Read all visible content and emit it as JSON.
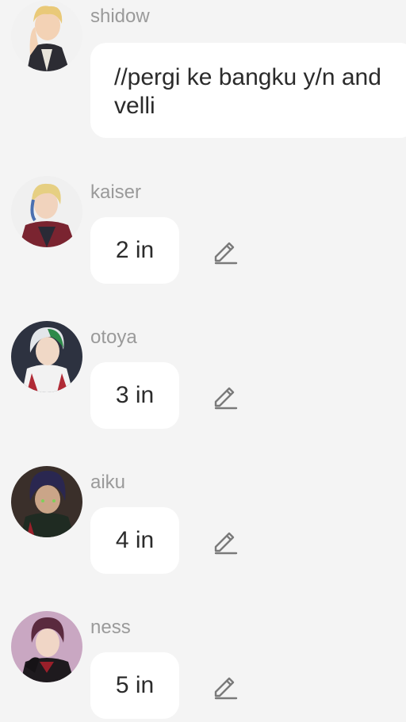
{
  "messages": [
    {
      "name": "shidow",
      "text": "//pergi ke bangku y/n and velli"
    },
    {
      "name": "kaiser",
      "text": "2 in"
    },
    {
      "name": "otoya",
      "text": "3 in"
    },
    {
      "name": "aiku",
      "text": "4 in"
    },
    {
      "name": "ness",
      "text": "5 in"
    }
  ],
  "icons": {
    "edit": "pencil-edit-icon"
  },
  "colors": {
    "background": "#f4f4f4",
    "bubble": "#ffffff",
    "name_text": "#9a9a9a",
    "message_text": "#2b2b2b",
    "icon": "#7a7a7a"
  }
}
